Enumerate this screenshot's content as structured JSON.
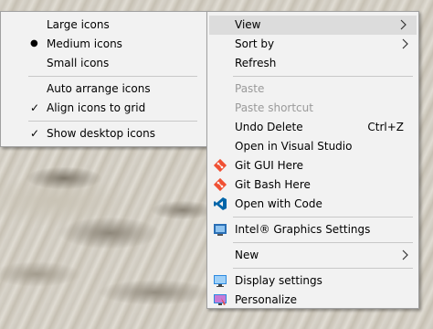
{
  "view_submenu": {
    "items": [
      {
        "label": "Large icons",
        "mark": ""
      },
      {
        "label": "Medium icons",
        "mark": "●"
      },
      {
        "label": "Small icons",
        "mark": ""
      },
      {
        "label": "Auto arrange icons",
        "mark": ""
      },
      {
        "label": "Align icons to grid",
        "mark": "✓"
      },
      {
        "label": "Show desktop icons",
        "mark": "✓"
      }
    ]
  },
  "context_menu": {
    "view": "View",
    "sort_by": "Sort by",
    "refresh": "Refresh",
    "paste": "Paste",
    "paste_shortcut": "Paste shortcut",
    "undo_delete": "Undo Delete",
    "undo_shortcut": "Ctrl+Z",
    "open_vs": "Open in Visual Studio",
    "git_gui": "Git GUI Here",
    "git_bash": "Git Bash Here",
    "open_code": "Open with Code",
    "intel": "Intel® Graphics Settings",
    "new": "New",
    "display_settings": "Display settings",
    "personalize": "Personalize"
  },
  "icons": {
    "submenu_arrow": "chevron-right-icon",
    "git_icon_color": "#f05033",
    "vscode_icon_color": "#0065a9",
    "intel_icon_color": "#2a6fb5",
    "display_icon_color": "#2d8ae0"
  }
}
